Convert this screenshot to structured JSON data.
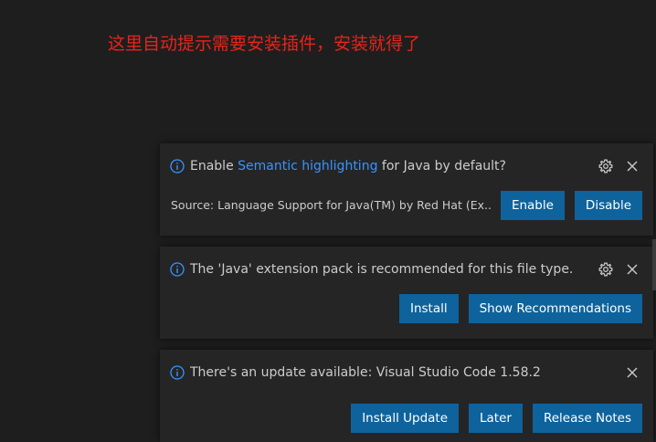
{
  "annotation": "这里自动提示需要安装插件，安装就得了",
  "notifications": [
    {
      "message_before": "Enable ",
      "message_link": "Semantic highlighting",
      "message_after": " for Java by default?",
      "source": "Source: Language Support for Java(TM) by Red Hat (Ex...",
      "buttons": [
        "Enable",
        "Disable"
      ]
    },
    {
      "message": "The 'Java' extension pack is recommended for this file type.",
      "buttons": [
        "Install",
        "Show Recommendations"
      ]
    },
    {
      "message": "There's an update available: Visual Studio Code 1.58.2",
      "buttons": [
        "Install Update",
        "Later",
        "Release Notes"
      ]
    }
  ],
  "icons": {
    "info": "info-icon",
    "settings": "gear-icon",
    "close": "close-icon"
  },
  "colors": {
    "background": "#1e1e1e",
    "toast": "#252526",
    "button": "#0e639c",
    "link": "#3794ff",
    "info": "#3794ff",
    "annotation": "#e8231b"
  }
}
